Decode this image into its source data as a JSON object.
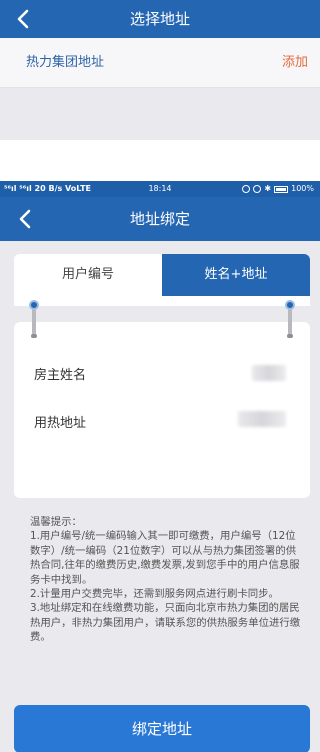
{
  "top_screen": {
    "title": "选择地址",
    "address_item": "热力集团地址",
    "add_label": "添加"
  },
  "status_bar": {
    "signal": "⁵⁶ıl ⁵⁶ıl 20 B/s VoLTE",
    "time": "18:14",
    "battery": "100%"
  },
  "bind_screen": {
    "title": "地址绑定",
    "tabs": [
      {
        "label": "用户编号",
        "active": false
      },
      {
        "label": "姓名+地址",
        "active": true
      }
    ],
    "fields": {
      "owner_name_label": "房主姓名",
      "heating_address_label": "用热地址"
    },
    "tips": {
      "heading": "温馨提示：",
      "items": [
        "1.用户编号/统一编码输入其一即可缴费，用户编号（12位数字）/统一编码（21位数字）可以从与热力集团签署的供热合同,往年的缴费历史,缴费发票,发到您手中的用户信息服务卡中找到。",
        "2.计量用户交费完毕，还需到服务网点进行刷卡同步。",
        "3.地址绑定和在线缴费功能，只面向北京市热力集团的居民热用户，非热力集团用户，请联系您的供热服务单位进行缴费。"
      ]
    },
    "bind_button": "绑定地址"
  },
  "colors": {
    "primary": "#2566b3",
    "button": "#2a78d6",
    "add_accent": "#e36b3d",
    "address_text": "#2d62a6"
  }
}
